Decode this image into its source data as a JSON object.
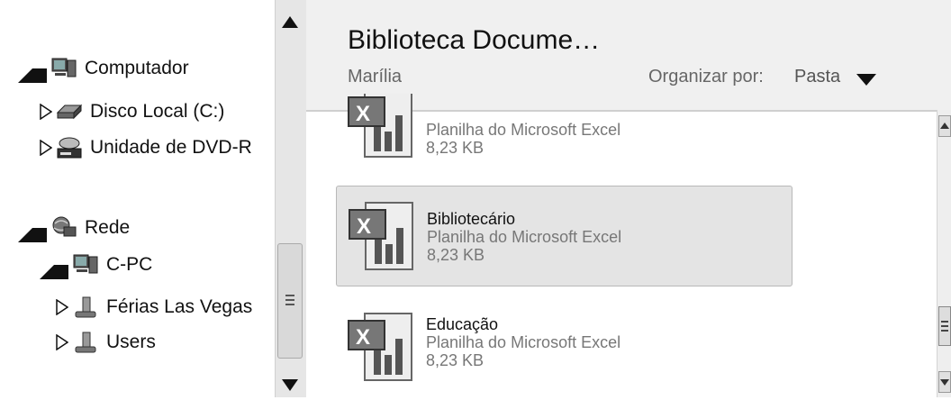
{
  "tree": {
    "items": [
      {
        "label": "Computador",
        "icon": "computer-icon",
        "state": "expanded"
      },
      {
        "label": "Disco Local (C:)",
        "icon": "drive-icon",
        "state": "collapsed"
      },
      {
        "label": "Unidade de DVD-R",
        "icon": "dvd-drive-icon",
        "state": "collapsed"
      },
      {
        "label": "Rede",
        "icon": "network-icon",
        "state": "expanded"
      },
      {
        "label": "C-PC",
        "icon": "computer-icon",
        "state": "expanded"
      },
      {
        "label": "Férias Las Vegas",
        "icon": "shared-folder-icon",
        "state": "collapsed"
      },
      {
        "label": "Users",
        "icon": "shared-folder-icon",
        "state": "collapsed"
      }
    ]
  },
  "header": {
    "title": "Biblioteca Docume…",
    "subtitle": "Marília",
    "organize_label": "Organizar por:",
    "organize_value": "Pasta"
  },
  "files": [
    {
      "name": "",
      "type": "Planilha do Microsoft Excel",
      "size": "8,23 KB"
    },
    {
      "name": "Bibliotecário",
      "type": "Planilha do Microsoft Excel",
      "size": "8,23 KB",
      "selected": true
    },
    {
      "name": "Educação",
      "type": "Planilha do Microsoft Excel",
      "size": "8,23 KB"
    }
  ]
}
